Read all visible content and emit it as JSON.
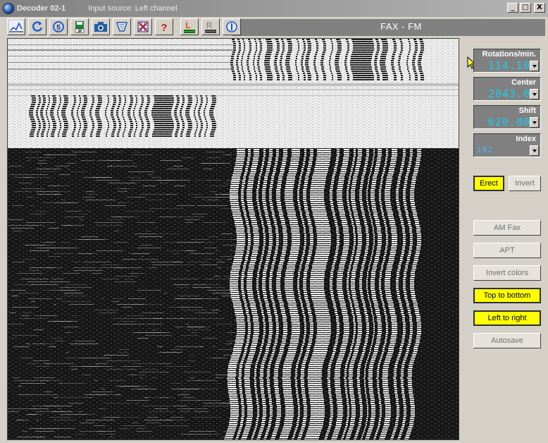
{
  "window": {
    "title": "Decoder 02-1",
    "source": "Input source: Left channel",
    "min_label": "_",
    "max_label": "□",
    "close_label": "X"
  },
  "mode": "FAX - FM",
  "toolbar": {
    "buttons": [
      {
        "name": "signal-icon",
        "glyph": "</>"
      },
      {
        "name": "refresh-icon",
        "glyph": "⟳"
      },
      {
        "name": "counter-icon",
        "glyph": "5"
      },
      {
        "name": "save-jpg-icon",
        "glyph": "💾"
      },
      {
        "name": "camera-icon",
        "glyph": "📷"
      },
      {
        "name": "filter-icon",
        "glyph": "◈"
      },
      {
        "name": "grid-icon",
        "glyph": "⊠"
      },
      {
        "name": "help-icon",
        "glyph": "?"
      },
      {
        "name": "left-channel-icon",
        "glyph": "L"
      },
      {
        "name": "right-channel-icon",
        "glyph": "R"
      },
      {
        "name": "info-icon",
        "glyph": "ⓘ"
      }
    ]
  },
  "params": {
    "rotations": {
      "label": "Rotations/min.",
      "value": "114.10"
    },
    "center": {
      "label": "Center",
      "value": "2043.0"
    },
    "shift": {
      "label": "Shift",
      "value": "620.00"
    },
    "index": {
      "label": "Index",
      "value": "192"
    }
  },
  "buttons": {
    "erect": "Erect",
    "invert": "Invert",
    "am_fax": "AM Fax",
    "apt": "APT",
    "invert_colors": "Invert colors",
    "top_to_bottom": "Top to bottom",
    "left_to_right": "Left to right",
    "autosave": "Autosave"
  },
  "colors": {
    "active_button": "#ffff00",
    "lcd_digits": "#14d0f0"
  }
}
